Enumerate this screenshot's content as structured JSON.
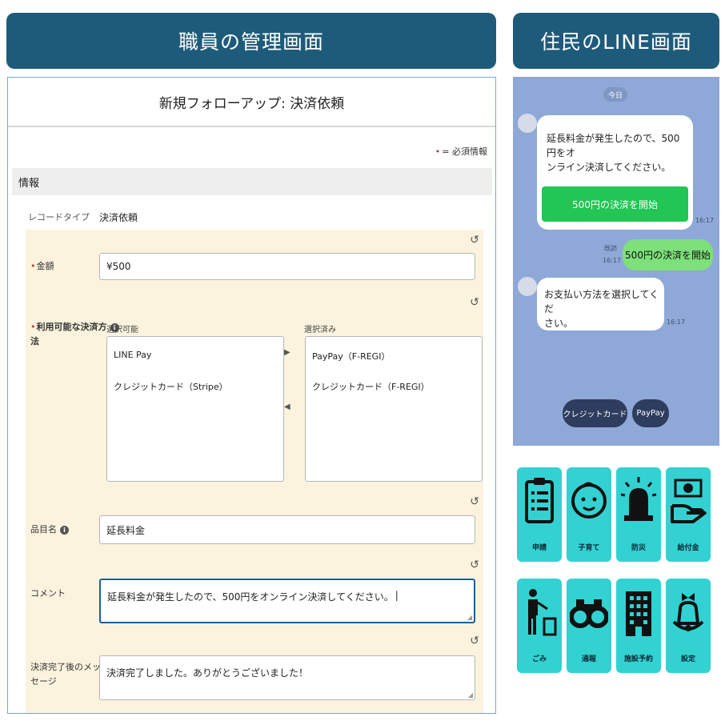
{
  "banners": {
    "left": "職員の管理画面",
    "right": "住民のLINE画面"
  },
  "admin": {
    "form_title": "新規フォローアップ: 決済依頼",
    "required_note": "= 必須情報",
    "section_info": "情報",
    "record_type_label": "レコードタイプ",
    "record_type_value": "決済依頼",
    "amount": {
      "label": "金額",
      "value": "¥500"
    },
    "payment_methods": {
      "label_line1": "利用可能な決済方",
      "label_line2": "法",
      "available_heading": "選択可能",
      "selected_heading": "選択済み",
      "available": [
        "LINE Pay",
        "クレジットカード（Stripe）"
      ],
      "selected": [
        "PayPay（F-REGI）",
        "クレジットカード（F-REGI）"
      ]
    },
    "item_name": {
      "label": "品目名",
      "value": "延長料金"
    },
    "comment": {
      "label": "コメント",
      "value": "延長料金が発生したので、500円をオンライン決済してください。"
    },
    "completion_message": {
      "label_line1": "決済完了後のメッ",
      "label_line2": "セージ",
      "value": "決済完了しました。ありがとうございました！"
    }
  },
  "chat": {
    "date_label": "今日",
    "message1": {
      "line1": "延長料金が発生したので、500円をオ",
      "line2": "ンライン決済してください。",
      "time": "16:17"
    },
    "pay_button": "500円の決済を開始",
    "user_reply": {
      "text": "500円の決済を開始",
      "read": "既読",
      "time": "16:17"
    },
    "message2": {
      "line1": "お支払い方法を選択してくだ",
      "line2": "さい。",
      "time": "16:17"
    },
    "quick_replies": [
      "クレジットカード",
      "PayPay"
    ]
  },
  "menu": [
    {
      "label": "申請",
      "icon": "clipboard-icon"
    },
    {
      "label": "子育て",
      "icon": "baby-icon"
    },
    {
      "label": "防災",
      "icon": "siren-icon"
    },
    {
      "label": "給付金",
      "icon": "money-hand-icon"
    },
    {
      "label": "ごみ",
      "icon": "trash-icon"
    },
    {
      "label": "通報",
      "icon": "binoculars-icon"
    },
    {
      "label": "施設予約",
      "icon": "building-icon"
    },
    {
      "label": "設定",
      "icon": "bell-icon"
    }
  ],
  "colors": {
    "banner": "#1e5b7a",
    "menu_tile": "#33d2d2",
    "chat_bg": "#8ea8d7",
    "line_green": "#21c655",
    "edit_bg": "#fbf3de"
  }
}
